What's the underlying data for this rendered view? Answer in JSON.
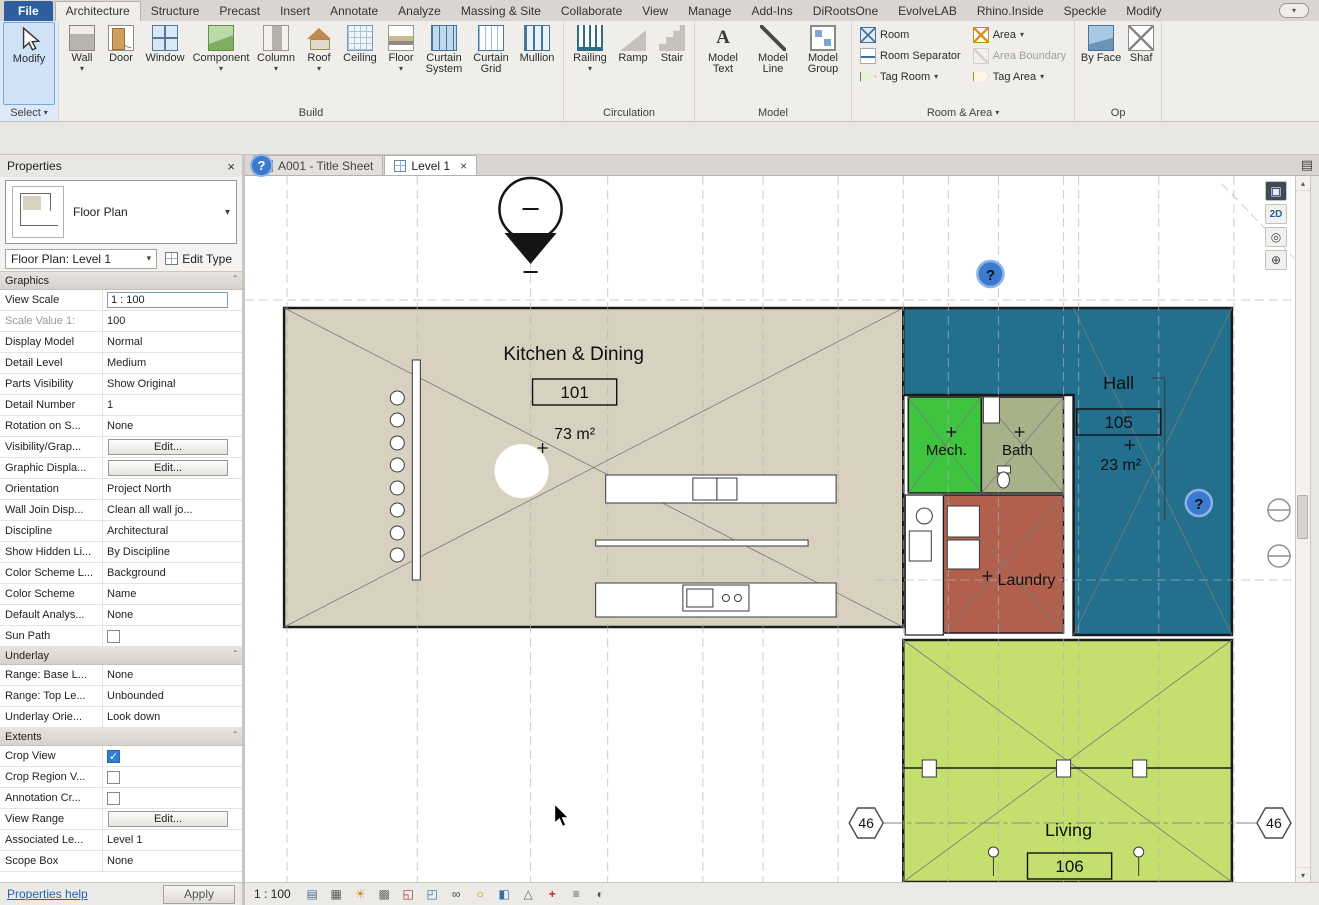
{
  "glyphs": {
    "close": "×",
    "caret_down": "▾",
    "caret_up": "▴",
    "chevron_up": "ˆ",
    "menu": "▤",
    "question": "?"
  },
  "ribbon": {
    "tabs": [
      "File",
      "Architecture",
      "Structure",
      "Precast",
      "Insert",
      "Annotate",
      "Analyze",
      "Massing & Site",
      "Collaborate",
      "View",
      "Manage",
      "Add-Ins",
      "DiRootsOne",
      "EvolveLAB",
      "Rhino.Inside",
      "Speckle",
      "Modify"
    ],
    "select": {
      "modify": "Modify",
      "label": "Select"
    },
    "build": {
      "label": "Build",
      "wall": "Wall",
      "door": "Door",
      "window": "Window",
      "component": "Component",
      "column": "Column",
      "roof": "Roof",
      "ceiling": "Ceiling",
      "floor": "Floor",
      "curtain_system": "Curtain System",
      "curtain_grid": "Curtain Grid",
      "mullion": "Mullion"
    },
    "circulation": {
      "label": "Circulation",
      "railing": "Railing",
      "ramp": "Ramp",
      "stair": "Stair"
    },
    "model": {
      "label": "Model",
      "model_text": "Model Text",
      "model_line": "Model Line",
      "model_group": "Model Group"
    },
    "room_area": {
      "label": "Room & Area",
      "room": "Room",
      "room_separator": "Room Separator",
      "tag_room": "Tag Room",
      "area": "Area",
      "area_boundary": "Area Boundary",
      "tag_area": "Tag Area"
    },
    "opening": {
      "label": "Op",
      "by_face": "By Face",
      "shaft": "Shaf"
    }
  },
  "properties": {
    "title": "Properties",
    "type_name": "Floor Plan",
    "instance": "Floor Plan: Level 1",
    "edit_type": "Edit Type",
    "sections": {
      "graphics": "Graphics",
      "underlay": "Underlay",
      "extents": "Extents"
    },
    "graphics_rows": [
      {
        "label": "View Scale",
        "value": "1 : 100"
      },
      {
        "label": "Scale Value 1:",
        "value": "100"
      },
      {
        "label": "Display Model",
        "value": "Normal"
      },
      {
        "label": "Detail Level",
        "value": "Medium"
      },
      {
        "label": "Parts Visibility",
        "value": "Show Original"
      },
      {
        "label": "Detail Number",
        "value": "1"
      },
      {
        "label": "Rotation on S...",
        "value": "None"
      },
      {
        "label": "Visibility/Grap...",
        "value": "Edit..."
      },
      {
        "label": "Graphic Displa...",
        "value": "Edit..."
      },
      {
        "label": "Orientation",
        "value": "Project North"
      },
      {
        "label": "Wall Join Disp...",
        "value": "Clean all wall jo..."
      },
      {
        "label": "Discipline",
        "value": "Architectural"
      },
      {
        "label": "Show Hidden Li...",
        "value": "By Discipline"
      },
      {
        "label": "Color Scheme L...",
        "value": "Background"
      },
      {
        "label": "Color Scheme",
        "value": "Name"
      },
      {
        "label": "Default Analys...",
        "value": "None"
      },
      {
        "label": "Sun Path",
        "value": "",
        "checked": false
      }
    ],
    "underlay_rows": [
      {
        "label": "Range: Base L...",
        "value": "None"
      },
      {
        "label": "Range: Top Le...",
        "value": "Unbounded"
      },
      {
        "label": "Underlay Orie...",
        "value": "Look down"
      }
    ],
    "extents_rows": [
      {
        "label": "Crop View",
        "value": "",
        "checked": true
      },
      {
        "label": "Crop Region V...",
        "value": "",
        "checked": false
      },
      {
        "label": "Annotation Cr...",
        "value": "",
        "checked": false
      },
      {
        "label": "View Range",
        "value": "Edit..."
      },
      {
        "label": "Associated Le...",
        "value": "Level 1"
      },
      {
        "label": "Scope Box",
        "value": "None"
      }
    ],
    "help_link": "Properties help",
    "apply": "Apply"
  },
  "canvas": {
    "tabs": [
      {
        "label": "A001 - Title Sheet"
      },
      {
        "label": "Level 1"
      }
    ],
    "nav": [
      {
        "name": "view-cube",
        "glyph": "▣"
      },
      {
        "name": "2d-mode",
        "glyph": "2D"
      },
      {
        "name": "steering-wheel",
        "glyph": "◎"
      },
      {
        "name": "zoom",
        "glyph": "⊕"
      }
    ],
    "plan": {
      "kitchen": {
        "name": "Kitchen & Dining",
        "number": "101",
        "area": "73 m²"
      },
      "hall": {
        "name": "Hall",
        "number": "105",
        "area": "23 m²"
      },
      "mech": {
        "name": "Mech."
      },
      "bath": {
        "name": "Bath"
      },
      "laundry": {
        "name": "Laundry"
      },
      "living": {
        "name": "Living",
        "number": "106"
      },
      "grid_left": "46",
      "grid_right": "46",
      "colors": {
        "kitchen": "#d8d1c0",
        "hall": "#23708e",
        "mech": "#3fc43f",
        "bath": "#a7b289",
        "laundry": "#b2604e",
        "living": "#c3df6e"
      }
    }
  },
  "view_bar": {
    "scale": "1 : 100",
    "icons": [
      {
        "name": "detail-level",
        "glyph": "▤"
      },
      {
        "name": "visual-style",
        "glyph": "▦"
      },
      {
        "name": "sun-path",
        "glyph": "☀"
      },
      {
        "name": "shadows",
        "glyph": "▩"
      },
      {
        "name": "crop-view",
        "glyph": "◱"
      },
      {
        "name": "show-crop-region",
        "glyph": "◰"
      },
      {
        "name": "temporary-hide-isolate",
        "glyph": "∞"
      },
      {
        "name": "reveal-hidden-elements",
        "glyph": "○"
      },
      {
        "name": "temporary-view-properties",
        "glyph": "◧"
      },
      {
        "name": "hide-analytical-model",
        "glyph": "△"
      },
      {
        "name": "reveal-constraints",
        "glyph": "+"
      },
      {
        "name": "worksharing-display",
        "glyph": "≡"
      },
      {
        "name": "editable-only",
        "glyph": "◐"
      }
    ]
  }
}
